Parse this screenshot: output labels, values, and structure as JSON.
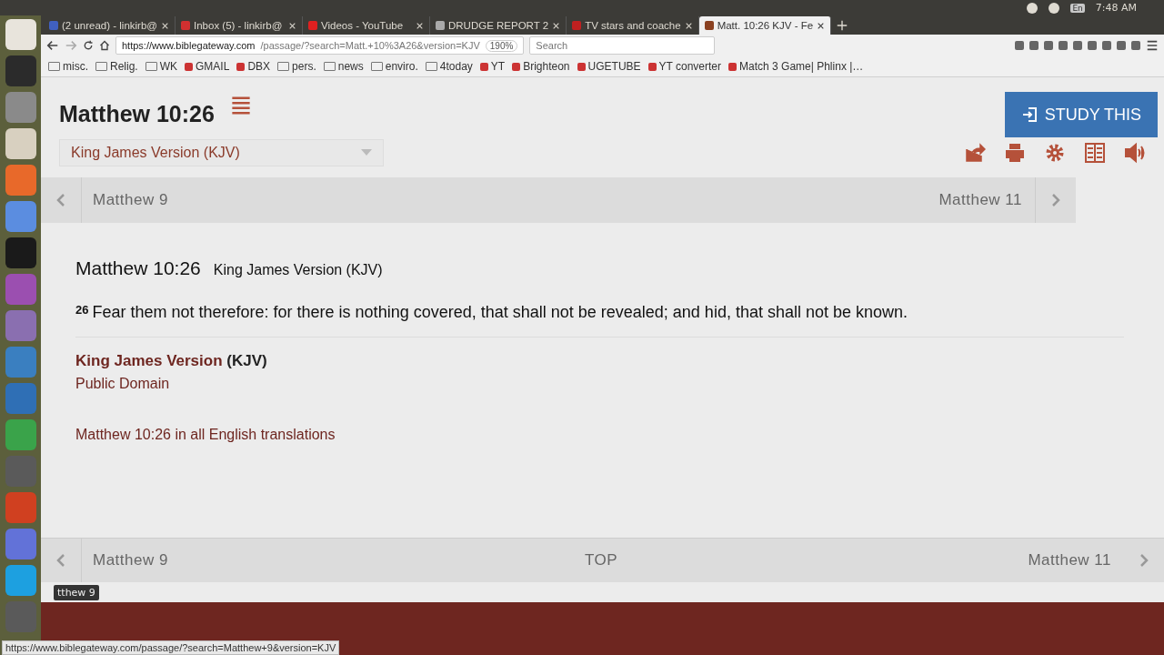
{
  "top_panel": {
    "keyboard": "En",
    "time": "7:48 AM"
  },
  "tabs": [
    {
      "title": "(2 unread) - linkirb@",
      "selected": false
    },
    {
      "title": "Inbox (5) - linkirb@",
      "selected": false
    },
    {
      "title": "Videos - YouTube",
      "selected": false
    },
    {
      "title": "DRUDGE REPORT 2",
      "selected": false
    },
    {
      "title": "TV stars and coache",
      "selected": false
    },
    {
      "title": "Matt. 10:26 KJV - Fe",
      "selected": true
    }
  ],
  "address_bar": {
    "url_host": "https://www.biblegateway.com",
    "url_path": "/passage/?search=Matt.+10%3A26&version=KJV",
    "zoom": "190%",
    "search_placeholder": "Search"
  },
  "bookmarks": [
    {
      "label": "misc.",
      "kind": "folder"
    },
    {
      "label": "Relig.",
      "kind": "folder"
    },
    {
      "label": "WK",
      "kind": "folder"
    },
    {
      "label": "GMAIL",
      "kind": "link"
    },
    {
      "label": "DBX",
      "kind": "link"
    },
    {
      "label": "pers.",
      "kind": "folder"
    },
    {
      "label": "news",
      "kind": "folder"
    },
    {
      "label": "enviro.",
      "kind": "folder"
    },
    {
      "label": "4today",
      "kind": "folder"
    },
    {
      "label": "YT",
      "kind": "link"
    },
    {
      "label": "Brighteon",
      "kind": "link"
    },
    {
      "label": "UGETUBE",
      "kind": "link"
    },
    {
      "label": "YT converter",
      "kind": "link"
    },
    {
      "label": "Match 3 Game| Phlinx |…",
      "kind": "link"
    }
  ],
  "page": {
    "title": "Matthew 10:26",
    "version_select": "King James Version (KJV)",
    "study_button": "STUDY THIS",
    "chapter_nav": {
      "previous": "Matthew 9",
      "next": "Matthew 11"
    },
    "passage": {
      "heading": "Matthew 10:26",
      "version": "King James Version (KJV)",
      "verse_number": "26",
      "verse_text": "Fear them not therefore: for there is nothing covered, that shall not be revealed; and hid, that shall not be known."
    },
    "copyright": {
      "version_name": "King James Version",
      "abbreviation": "(KJV)",
      "notice": "Public Domain"
    },
    "all_translations_link": "Matthew 10:26 in all English translations",
    "bottom_nav": {
      "previous": "Matthew 9",
      "top": "TOP",
      "next": "Matthew 11"
    }
  },
  "tooltip": "tthew 9",
  "status_url": "https://www.biblegateway.com/passage/?search=Matthew+9&version=KJV"
}
